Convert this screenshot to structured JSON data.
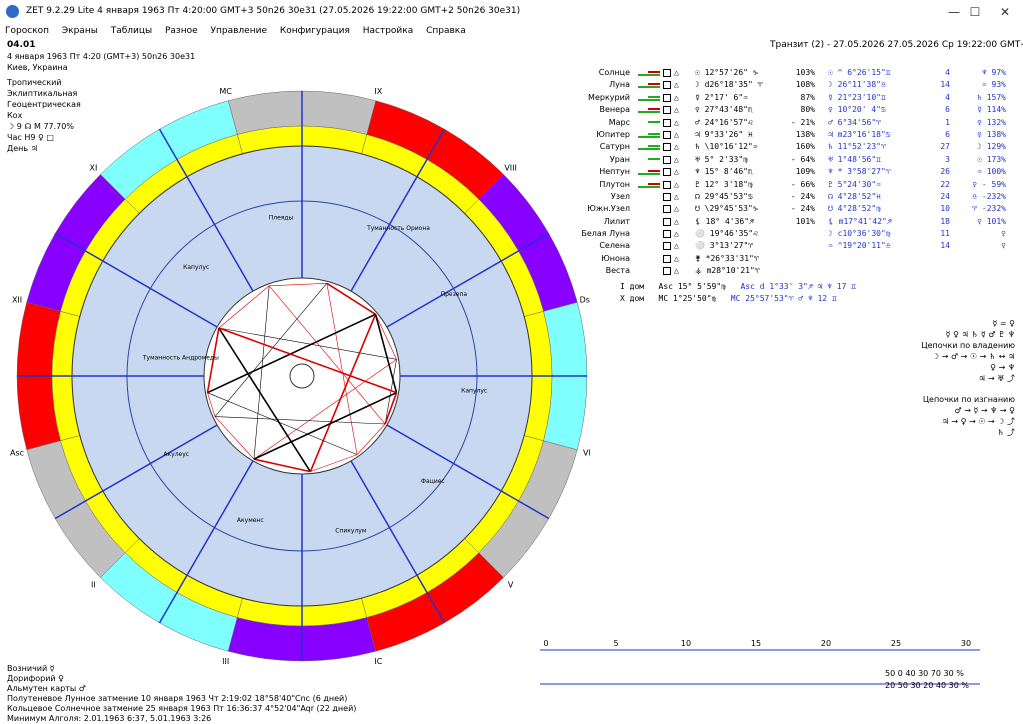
{
  "window": {
    "title": "ZET 9.2.29 Lite     4 января 1963   Пт   4:20:00 GMT+3 50n26  30e31   (27.05.2026  19:22:00 GMT+2 50n26 30e31)",
    "minimize": "—",
    "maximize": "☐",
    "close": "✕"
  },
  "menu": [
    "Гороскоп",
    "Экраны",
    "Таблицы",
    "Разное",
    "Управление",
    "Конфигурация",
    "Настройка",
    "Справка"
  ],
  "info": {
    "id": "04.01",
    "line1": "4 января 1963  Пт  4:20 (GMT+3) 50n26  30e31",
    "line2": "Киев, Украина",
    "line3": "Тропический",
    "line4": "Эклиптикальная",
    "line5": "Геоцентрическая",
    "line6": "Кох",
    "line7": "☽ 9 ☊ M 77.70%",
    "line8": "Час H9 ♀ □",
    "line9": "День ♃"
  },
  "transit_header": "Транзит (2) - 27.05.2026 27.05.2026  Ср 19:22:00 GMT+2",
  "planets": [
    {
      "name": "Солнце",
      "sym": "☉",
      "pos": "12°57'26\" ♑",
      "pct": "103%",
      "tpos": "☉ ^ 6°26'15\"♊",
      "tn": "4",
      "tpct": "♆   97%",
      "bars": [
        "#c00",
        "#2a2"
      ]
    },
    {
      "name": "Луна",
      "sym": "☽",
      "pos": "d26°18'35\" ♈",
      "pct": "108%",
      "tpos": "☽   26°11'38\"♎",
      "tn": "14",
      "tpct": "♒   93%",
      "bars": [
        "#c00",
        "#2a2"
      ]
    },
    {
      "name": "Меркурий",
      "sym": "☿",
      "pos": "2°17' 6\"♒",
      "pct": "87%",
      "tpos": "☿   21°23'10\"♊",
      "tn": "4",
      "tpct": "♄  157%",
      "bars": [
        "#2a2",
        "#2a2"
      ]
    },
    {
      "name": "Венера",
      "sym": "♀",
      "pos": "27°43'48\"♏",
      "pct": "80%",
      "tpos": "♀   10°20' 4\"♋",
      "tn": "6",
      "tpct": "☿  114%",
      "bars": [
        "#c00",
        "#2a2"
      ]
    },
    {
      "name": "Марс",
      "sym": "♂",
      "pos": "24°16'57\"♌",
      "pct": "- 21%",
      "tpos": "♂   6°34'56\"♈",
      "tn": "1",
      "tpct": "♀  132%",
      "bars": [
        "#2a2"
      ]
    },
    {
      "name": "Юпитер",
      "sym": "♃",
      "pos": "9°33'26\" ♓",
      "pct": "138%",
      "tpos": "♃ m23°16'18\"♋",
      "tn": "6",
      "tpct": "♀  138%",
      "bars": [
        "#2a2",
        "#2a2"
      ]
    },
    {
      "name": "Сатурн",
      "sym": "♄",
      "pos": "\\10°16'12\"♒",
      "pct": "160%",
      "tpos": "♄   11°52'23\"♈",
      "tn": "27",
      "tpct": "☽  129%",
      "bars": [
        "#2a2",
        "#2a2"
      ]
    },
    {
      "name": "Уран",
      "sym": "♅",
      "pos": "5° 2'33\"♍",
      "pct": "- 64%",
      "tpos": "♅   1°48'56\"♊",
      "tn": "3",
      "tpct": "☉  173%",
      "bars": [
        "#2a2"
      ]
    },
    {
      "name": "Нептун",
      "sym": "♆",
      "pos": "15° 8'46\"♏",
      "pct": "109%",
      "tpos": "♆ * 3°58'27\"♈",
      "tn": "26",
      "tpct": "♒  100%",
      "bars": [
        "#c00",
        "#2a2"
      ]
    },
    {
      "name": "Плутон",
      "sym": "♇",
      "pos": "12° 3'18\"♍",
      "pct": "- 66%",
      "tpos": "♇   5°24'30\"♒",
      "tn": "22",
      "tpct": "♀ - 59%",
      "bars": [
        "#c00",
        "#2a2"
      ]
    },
    {
      "name": "Узел",
      "sym": "☊",
      "pos": "29°45'53\"♋",
      "pct": "- 24%",
      "tpos": "☊   4°28'52\"♓",
      "tn": "24",
      "tpct": "♎ -232%",
      "bars": []
    },
    {
      "name": "Южн.Узел",
      "sym": "☋",
      "pos": "\\29°45'53\"♑",
      "pct": "- 24%",
      "tpos": "☋   4°28'52\"♍",
      "tn": "10",
      "tpct": "♈ -232%",
      "bars": []
    },
    {
      "name": "Лилит",
      "sym": "⚸",
      "pos": "18° 4'36\"♐",
      "pct": "101%",
      "tpos": "⚸ m17°41'42\"♐",
      "tn": "18",
      "tpct": "♀  101%",
      "bars": []
    },
    {
      "name": "Белая Луна",
      "sym": "⚪",
      "pos": "19°46'35\"♌",
      "pct": "",
      "tpos": "☽ c10°36'30\"♍",
      "tn": "11",
      "tpct": "♀",
      "bars": []
    },
    {
      "name": "Селена",
      "sym": "⚪",
      "pos": "3°13'27\"♈",
      "pct": "",
      "tpos": "♒ ^19°20'11\"♎",
      "tn": "14",
      "tpct": "♀",
      "bars": []
    },
    {
      "name": "Юнона",
      "sym": "⚵",
      "pos": "*26°33'31\"♈",
      "pct": "",
      "tpos": "",
      "tn": "",
      "tpct": "",
      "bars": []
    },
    {
      "name": "Веста",
      "sym": "⚶",
      "pos": "m28°10'21\"♈",
      "pct": "",
      "tpos": "",
      "tn": "",
      "tpct": "",
      "bars": []
    }
  ],
  "houses_info": [
    {
      "label": "I дом",
      "val": "Asc  15° 5'59\"♍",
      "tval": "Asc d 1°33' 3\"♐  ♃ ♆  17  ♊"
    },
    {
      "label": "X дом",
      "val": "MC   1°25'50\"♍",
      "tval": "MC  25°57'53\"♈  ♂ ♆  12  ♊"
    }
  ],
  "chains": {
    "top": "☿ = ♀",
    "row1": "☿ ♀ ♃ ♄ ☿ ♂ ♇ ♆",
    "title1": "Цепочки по владению",
    "l1": "☽ → ♂ → ☉ → ♄ ↔ ♃",
    "l2": "♀ → ♆",
    "l3": "♃ → ♅ ⤴",
    "title2": "Цепочки по изгнанию",
    "l4": "♂ → ☿ → ♆ → ♀",
    "l5": "♃ → ♀ → ☉ → ☽ ⤴",
    "l6": "♄ ⤴"
  },
  "bottom": {
    "b1": "Возничий  ☿",
    "b2": "Дорифорий  ♀",
    "b3": "Альмутен карты  ♂",
    "b4": "Полутеневое Лунное затмение 10 января 1963 Чт  2:19:02 18°58'40\"Cnc (6 дней)",
    "b5": "Кольцевое Солнечное затмение 25 января 1963 Пт 16:36:37  4°52'04\"Aqr (22 дней)",
    "b6": "Минимум Алголя: 2.01.1963  6:37, 5.01.1963  3:26"
  },
  "scale": {
    "ticks": [
      "0",
      "5",
      "10",
      "15",
      "20",
      "25",
      "30"
    ],
    "grid1": "50  0  40  30  70  30 %",
    "grid2": "20  50  30  20  40  30 %"
  },
  "wheel": {
    "house_labels": [
      "Asc",
      "II",
      "III",
      "IC",
      "V",
      "VI",
      "Dsc",
      "VIII",
      "IX",
      "MC",
      "XI",
      "XII"
    ],
    "stars": [
      "Презепа",
      "Туманность Ориона",
      "Плеяды",
      "Капулус",
      "Туманность Андромеды",
      "Акулеус",
      "Акуменс",
      "Спикулум",
      "Фациес",
      "Капулус"
    ],
    "colors": {
      "fire": "#ff0000",
      "earth": "#c0c0c0",
      "air": "#80ffff",
      "water": "#8800ff",
      "signs": "#ffff00",
      "inner": "#c8d8f0"
    }
  }
}
